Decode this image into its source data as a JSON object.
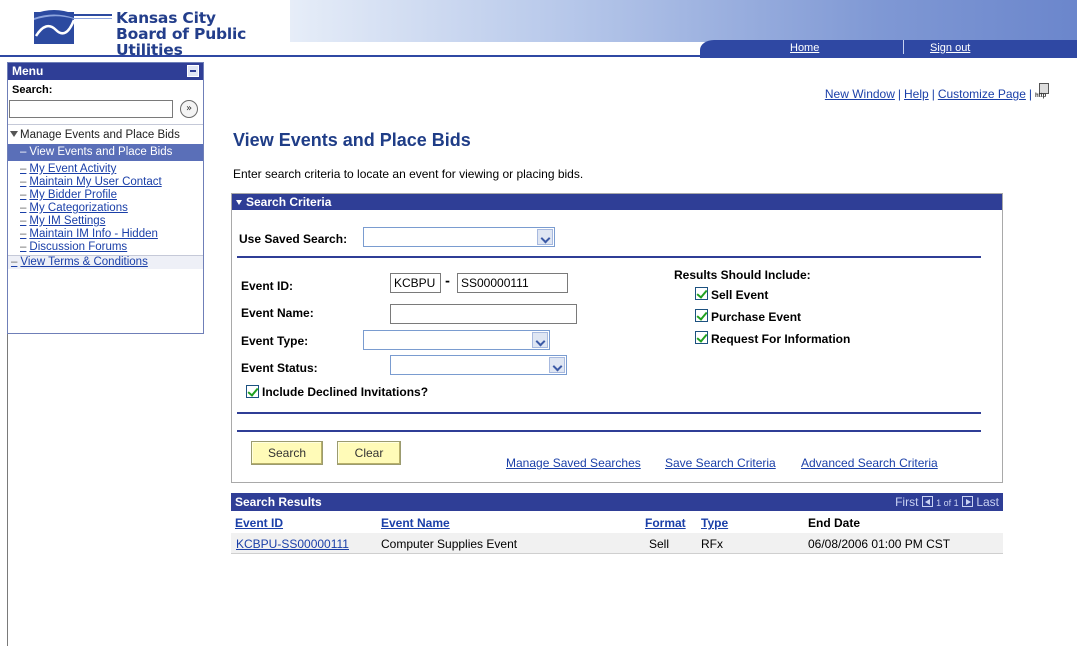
{
  "header": {
    "org_line1": "Kansas City",
    "org_line2": "Board of Public Utilities",
    "nav_home": "Home",
    "nav_signout": "Sign out"
  },
  "menu": {
    "title": "Menu",
    "search_label": "Search:",
    "go_glyph": "»",
    "group": "Manage Events and Place Bids",
    "items": [
      "View Events and Place Bids",
      "My Event Activity",
      "Maintain My User Contact",
      "My Bidder Profile",
      "My Categorizations",
      "My IM Settings",
      "Maintain IM Info - Hidden",
      "Discussion Forums"
    ],
    "bottom_item": "View Terms & Conditions",
    "active_index": 0
  },
  "top_links": {
    "new_window": "New Window",
    "help": "Help",
    "customize": "Customize Page",
    "http_icon_text": "http"
  },
  "page": {
    "title": "View Events and Place Bids",
    "instruction": "Enter search criteria to locate an event for viewing or placing bids."
  },
  "criteria": {
    "header": "Search Criteria",
    "saved_search_label": "Use Saved Search:",
    "event_id_label": "Event ID:",
    "event_id_prefix": "KCBPU",
    "event_id_sep": "-",
    "event_id_value": "SS00000111",
    "event_name_label": "Event Name:",
    "event_type_label": "Event Type:",
    "event_status_label": "Event Status:",
    "include_declined_label": "Include Declined Invitations?",
    "results_include_label": "Results Should Include:",
    "sell_event": "Sell Event",
    "purchase_event": "Purchase Event",
    "request_info": "Request For Information",
    "search_button": "Search",
    "clear_button": "Clear",
    "manage_saved": "Manage Saved Searches",
    "save_criteria": "Save Search Criteria",
    "advanced": "Advanced Search Criteria"
  },
  "results": {
    "header": "Search Results",
    "pager_first": "First",
    "pager_range": "1 of 1",
    "pager_last": "Last",
    "columns": [
      "Event ID",
      "Event Name",
      "Format",
      "Type",
      "End Date"
    ],
    "rows": [
      {
        "event_id": "KCBPU-SS00000111",
        "event_name": "Computer Supplies Event",
        "format": "Sell",
        "type": "RFx",
        "end_date": "06/08/2006 01:00 PM CST"
      }
    ]
  },
  "colors": {
    "brand_blue": "#2f3e96",
    "title_blue": "#1f3d87",
    "link_blue": "#1a3fa8",
    "button_yellow": "#fffbb8"
  }
}
